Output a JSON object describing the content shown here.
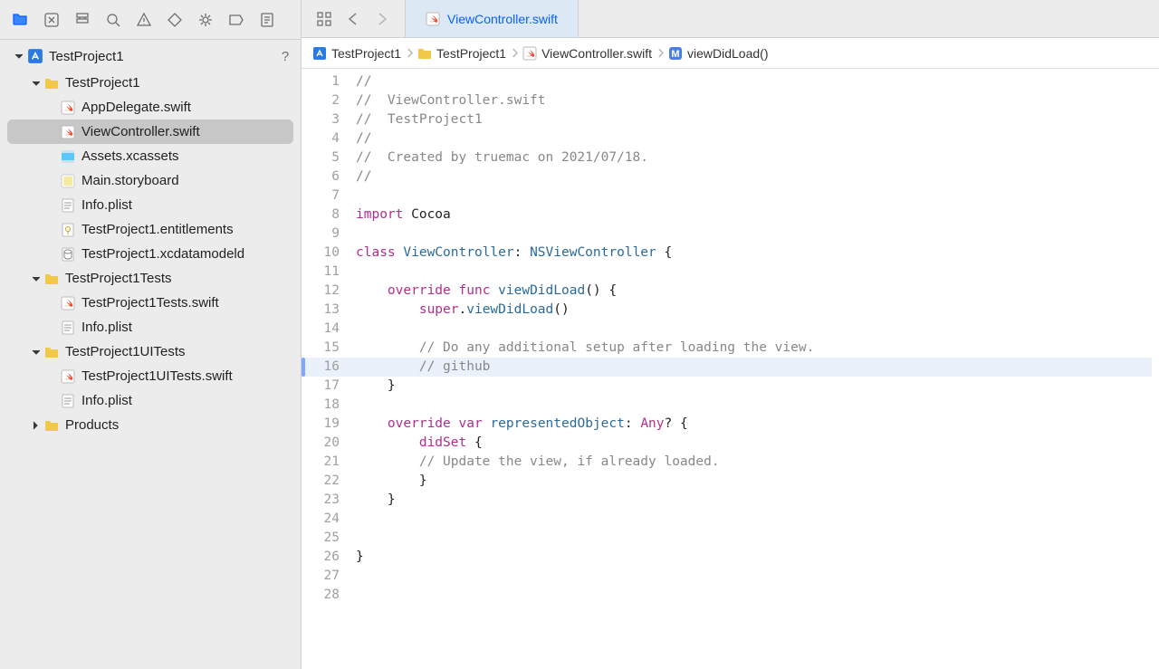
{
  "sidebar": {
    "project": "TestProject1",
    "help_glyph": "?",
    "tree": [
      {
        "indent": 1,
        "disclosure": "down",
        "icon": "folder-y",
        "label": "TestProject1"
      },
      {
        "indent": 2,
        "disclosure": "",
        "icon": "swift",
        "label": "AppDelegate.swift"
      },
      {
        "indent": 2,
        "disclosure": "",
        "icon": "swift",
        "label": "ViewController.swift",
        "selected": true
      },
      {
        "indent": 2,
        "disclosure": "",
        "icon": "assets",
        "label": "Assets.xcassets"
      },
      {
        "indent": 2,
        "disclosure": "",
        "icon": "storyboard",
        "label": "Main.storyboard"
      },
      {
        "indent": 2,
        "disclosure": "",
        "icon": "plist",
        "label": "Info.plist"
      },
      {
        "indent": 2,
        "disclosure": "",
        "icon": "entitle",
        "label": "TestProject1.entitlements"
      },
      {
        "indent": 2,
        "disclosure": "",
        "icon": "datamodel",
        "label": "TestProject1.xcdatamodeld"
      },
      {
        "indent": 1,
        "disclosure": "down",
        "icon": "folder-y",
        "label": "TestProject1Tests"
      },
      {
        "indent": 2,
        "disclosure": "",
        "icon": "swift",
        "label": "TestProject1Tests.swift"
      },
      {
        "indent": 2,
        "disclosure": "",
        "icon": "plist",
        "label": "Info.plist"
      },
      {
        "indent": 1,
        "disclosure": "down",
        "icon": "folder-y",
        "label": "TestProject1UITests"
      },
      {
        "indent": 2,
        "disclosure": "",
        "icon": "swift",
        "label": "TestProject1UITests.swift"
      },
      {
        "indent": 2,
        "disclosure": "",
        "icon": "plist",
        "label": "Info.plist"
      },
      {
        "indent": 1,
        "disclosure": "right",
        "icon": "folder-y",
        "label": "Products"
      }
    ]
  },
  "tab": {
    "label": "ViewController.swift"
  },
  "breadcrumb": [
    {
      "icon": "proj",
      "label": "TestProject1"
    },
    {
      "icon": "folder-y",
      "label": "TestProject1"
    },
    {
      "icon": "swift",
      "label": "ViewController.swift"
    },
    {
      "icon": "method",
      "label": "viewDidLoad()"
    }
  ],
  "code": {
    "highlighted_line": 16,
    "changed_lines": [
      16
    ],
    "lines": [
      {
        "n": 1,
        "tokens": [
          [
            "cm",
            "//"
          ]
        ]
      },
      {
        "n": 2,
        "tokens": [
          [
            "cm",
            "//  ViewController.swift"
          ]
        ]
      },
      {
        "n": 3,
        "tokens": [
          [
            "cm",
            "//  TestProject1"
          ]
        ]
      },
      {
        "n": 4,
        "tokens": [
          [
            "cm",
            "//"
          ]
        ]
      },
      {
        "n": 5,
        "tokens": [
          [
            "cm",
            "//  Created by truemac on 2021/07/18."
          ]
        ]
      },
      {
        "n": 6,
        "tokens": [
          [
            "cm",
            "//"
          ]
        ]
      },
      {
        "n": 7,
        "tokens": []
      },
      {
        "n": 8,
        "tokens": [
          [
            "kw",
            "import"
          ],
          [
            "",
            " Cocoa"
          ]
        ]
      },
      {
        "n": 9,
        "tokens": []
      },
      {
        "n": 10,
        "tokens": [
          [
            "kw",
            "class"
          ],
          [
            "",
            " "
          ],
          [
            "typ",
            "ViewController"
          ],
          [
            "",
            ": "
          ],
          [
            "typ",
            "NSViewController"
          ],
          [
            "",
            " {"
          ]
        ]
      },
      {
        "n": 11,
        "tokens": []
      },
      {
        "n": 12,
        "tokens": [
          [
            "",
            "    "
          ],
          [
            "kw",
            "override"
          ],
          [
            "",
            " "
          ],
          [
            "kw",
            "func"
          ],
          [
            "",
            " "
          ],
          [
            "typ",
            "viewDidLoad"
          ],
          [
            "",
            "() {"
          ]
        ]
      },
      {
        "n": 13,
        "tokens": [
          [
            "",
            "        "
          ],
          [
            "kw",
            "super"
          ],
          [
            "",
            "."
          ],
          [
            "typ",
            "viewDidLoad"
          ],
          [
            "",
            "()"
          ]
        ]
      },
      {
        "n": 14,
        "tokens": []
      },
      {
        "n": 15,
        "tokens": [
          [
            "",
            "        "
          ],
          [
            "cm",
            "// Do any additional setup after loading the view."
          ]
        ]
      },
      {
        "n": 16,
        "tokens": [
          [
            "",
            "        "
          ],
          [
            "cm",
            "// github"
          ]
        ]
      },
      {
        "n": 17,
        "tokens": [
          [
            "",
            "    }"
          ]
        ]
      },
      {
        "n": 18,
        "tokens": []
      },
      {
        "n": 19,
        "tokens": [
          [
            "",
            "    "
          ],
          [
            "kw",
            "override"
          ],
          [
            "",
            " "
          ],
          [
            "kw",
            "var"
          ],
          [
            "",
            " "
          ],
          [
            "typ",
            "representedObject"
          ],
          [
            "",
            ": "
          ],
          [
            "kw",
            "Any"
          ],
          [
            "",
            "? {"
          ]
        ]
      },
      {
        "n": 20,
        "tokens": [
          [
            "",
            "        "
          ],
          [
            "kw",
            "didSet"
          ],
          [
            "",
            " {"
          ]
        ]
      },
      {
        "n": 21,
        "tokens": [
          [
            "",
            "        "
          ],
          [
            "cm",
            "// Update the view, if already loaded."
          ]
        ]
      },
      {
        "n": 22,
        "tokens": [
          [
            "",
            "        }"
          ]
        ]
      },
      {
        "n": 23,
        "tokens": [
          [
            "",
            "    }"
          ]
        ]
      },
      {
        "n": 24,
        "tokens": []
      },
      {
        "n": 25,
        "tokens": []
      },
      {
        "n": 26,
        "tokens": [
          [
            "",
            "}"
          ]
        ]
      },
      {
        "n": 27,
        "tokens": []
      },
      {
        "n": 28,
        "tokens": []
      }
    ]
  }
}
